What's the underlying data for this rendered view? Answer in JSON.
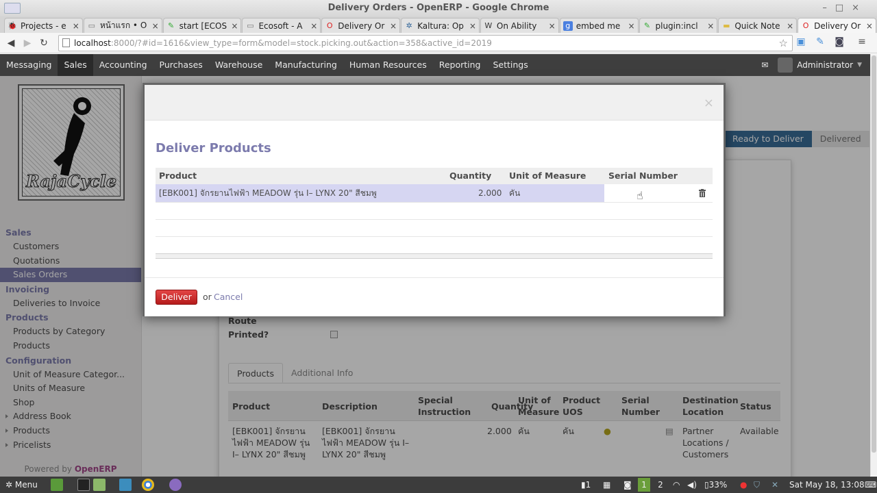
{
  "window": {
    "title": "Delivery Orders - OpenERP - Google Chrome"
  },
  "tabs": [
    {
      "label": "Projects - e",
      "icon": "bug-icon",
      "active": false
    },
    {
      "label": "หน้าแรก • O",
      "icon": "page-icon",
      "active": false
    },
    {
      "label": "start [ECOS",
      "icon": "edit-icon",
      "active": false
    },
    {
      "label": "Ecosoft - A",
      "icon": "page-icon",
      "active": false
    },
    {
      "label": "Delivery Or",
      "icon": "opera-icon",
      "active": false
    },
    {
      "label": "Kaltura: Op",
      "icon": "kaltura-icon",
      "active": false
    },
    {
      "label": "On Ability",
      "icon": "wordpress-icon",
      "active": false
    },
    {
      "label": "embed me",
      "icon": "google-icon",
      "active": false
    },
    {
      "label": "plugin:incl",
      "icon": "edit-icon",
      "active": false
    },
    {
      "label": "Quick Note",
      "icon": "note-icon",
      "active": false
    },
    {
      "label": "Delivery Or",
      "icon": "opera-icon",
      "active": true
    }
  ],
  "address": {
    "host": "localhost",
    "rest": ":8000/?#id=1616&view_type=form&model=stock.picking.out&action=358&active_id=2019"
  },
  "topmenu": {
    "items": [
      "Messaging",
      "Sales",
      "Accounting",
      "Purchases",
      "Warehouse",
      "Manufacturing",
      "Human Resources",
      "Reporting",
      "Settings"
    ],
    "active_index": 1,
    "user": "Administrator"
  },
  "logo_text": "RajaCycle",
  "sidebar": {
    "sections": [
      {
        "title": "Sales",
        "items": [
          {
            "label": "Customers"
          },
          {
            "label": "Quotations"
          },
          {
            "label": "Sales Orders",
            "active": true
          }
        ]
      },
      {
        "title": "Invoicing",
        "items": [
          {
            "label": "Deliveries to Invoice"
          }
        ]
      },
      {
        "title": "Products",
        "items": [
          {
            "label": "Products by Category"
          },
          {
            "label": "Products"
          }
        ]
      },
      {
        "title": "Configuration",
        "items": [
          {
            "label": "Unit of Measure Categor..."
          },
          {
            "label": "Units of Measure"
          },
          {
            "label": "Shop"
          },
          {
            "label": "Address Book",
            "expandable": true
          },
          {
            "label": "Products",
            "expandable": true
          },
          {
            "label": "Pricelists",
            "expandable": true
          }
        ]
      }
    ],
    "powered_by": "Powered by",
    "powered_brand": "OpenERP"
  },
  "form": {
    "stages": [
      "Ready to Deliver",
      "Delivered"
    ],
    "current_stage": "Ready to Deliver",
    "route_label": "Route",
    "printed_label": "Printed?",
    "notebook_tabs": [
      "Products",
      "Additional Info"
    ],
    "columns": {
      "product": "Product",
      "description": "Description",
      "special": "Special Instruction",
      "quantity": "Quantity",
      "uom": "Unit of Measure",
      "uos": "Product UOS",
      "serial": "Serial Number",
      "dest": "Destination Location",
      "status": "Status"
    },
    "row": {
      "product": "[EBK001] จักรยานไฟฟ้า MEADOW รุ่น I– LYNX 20\" สีชมพู",
      "description": "[EBK001] จักรยานไฟฟ้า MEADOW รุ่น I– LYNX 20\" สีชมพู",
      "quantity": "2.000",
      "uom": "คัน",
      "uos": "คัน",
      "dest": "Partner Locations / Customers",
      "status": "Available"
    }
  },
  "modal": {
    "title": "Deliver Products",
    "close": "×",
    "columns": {
      "product": "Product",
      "quantity": "Quantity",
      "uom": "Unit of Measure",
      "serial": "Serial Number"
    },
    "row": {
      "product": "[EBK001] จักรยานไฟฟ้า MEADOW รุ่น I– LYNX 20\" สีชมพู",
      "quantity": "2.000",
      "uom": "คัน"
    },
    "deliver_label": "Deliver",
    "or_label": "or",
    "cancel_label": "Cancel"
  },
  "taskbar": {
    "menu_label": "Menu",
    "tray": {
      "notifications": "1",
      "battery": "33%",
      "workspaces": [
        "1",
        "2"
      ],
      "clock": "Sat May 18, 13:08"
    }
  },
  "colors": {
    "accent": "#7c7bad",
    "deliver_button": "#c82a2a",
    "topbar": "#3e3e3e",
    "stage_current": "#3a6d99"
  }
}
